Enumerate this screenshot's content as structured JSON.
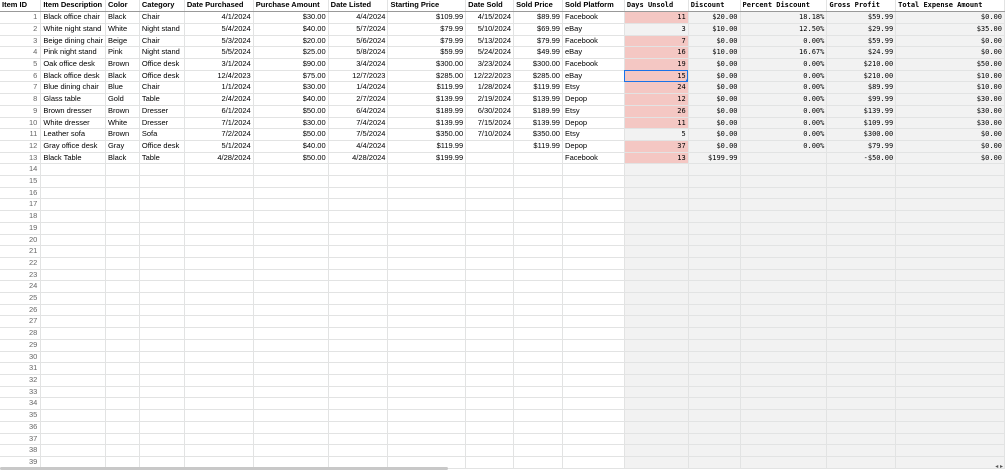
{
  "columns": [
    "Item ID",
    "Item Description",
    "Color",
    "Category",
    "Date Purchased",
    "Purchase Amount",
    "Date Listed",
    "Starting Price",
    "Date Sold",
    "Sold Price",
    "Sold Platform",
    "Days Unsold",
    "Discount",
    "Percent Discount",
    "Gross Profit",
    "Total Expense Amount"
  ],
  "rows": [
    [
      "1",
      "Black office chair",
      "Black",
      "Chair",
      "4/1/2024",
      "$30.00",
      "4/4/2024",
      "$109.99",
      "4/15/2024",
      "$89.99",
      "Facebook",
      "11",
      "$20.00",
      "18.18%",
      "$59.99",
      "$0.00"
    ],
    [
      "2",
      "White night stand",
      "White",
      "Night stand",
      "5/4/2024",
      "$40.00",
      "5/7/2024",
      "$79.99",
      "5/10/2024",
      "$69.99",
      "eBay",
      "3",
      "$10.00",
      "12.50%",
      "$29.99",
      "$35.00"
    ],
    [
      "3",
      "Beige dining chair",
      "Beige",
      "Chair",
      "5/3/2024",
      "$20.00",
      "5/6/2024",
      "$79.99",
      "5/13/2024",
      "$79.99",
      "Facebook",
      "7",
      "$0.00",
      "0.00%",
      "$59.99",
      "$0.00"
    ],
    [
      "4",
      "Pink night stand",
      "Pink",
      "Night stand",
      "5/5/2024",
      "$25.00",
      "5/8/2024",
      "$59.99",
      "5/24/2024",
      "$49.99",
      "eBay",
      "16",
      "$10.00",
      "16.67%",
      "$24.99",
      "$0.00"
    ],
    [
      "5",
      "Oak office desk",
      "Brown",
      "Office desk",
      "3/1/2024",
      "$90.00",
      "3/4/2024",
      "$300.00",
      "3/23/2024",
      "$300.00",
      "Facebook",
      "19",
      "$0.00",
      "0.00%",
      "$210.00",
      "$50.00"
    ],
    [
      "6",
      "Black office desk",
      "Black",
      "Office desk",
      "12/4/2023",
      "$75.00",
      "12/7/2023",
      "$285.00",
      "12/22/2023",
      "$285.00",
      "eBay",
      "15",
      "$0.00",
      "0.00%",
      "$210.00",
      "$10.00"
    ],
    [
      "7",
      "Blue dining chair",
      "Blue",
      "Chair",
      "1/1/2024",
      "$30.00",
      "1/4/2024",
      "$119.99",
      "1/28/2024",
      "$119.99",
      "Etsy",
      "24",
      "$0.00",
      "0.00%",
      "$89.99",
      "$10.00"
    ],
    [
      "8",
      "Glass table",
      "Gold",
      "Table",
      "2/4/2024",
      "$40.00",
      "2/7/2024",
      "$139.99",
      "2/19/2024",
      "$139.99",
      "Depop",
      "12",
      "$0.00",
      "0.00%",
      "$99.99",
      "$30.00"
    ],
    [
      "9",
      "Brown dresser",
      "Brown",
      "Dresser",
      "6/1/2024",
      "$50.00",
      "6/4/2024",
      "$189.99",
      "6/30/2024",
      "$189.99",
      "Etsy",
      "26",
      "$0.00",
      "0.00%",
      "$139.99",
      "$30.00"
    ],
    [
      "10",
      "White dresser",
      "White",
      "Dresser",
      "7/1/2024",
      "$30.00",
      "7/4/2024",
      "$139.99",
      "7/15/2024",
      "$139.99",
      "Depop",
      "11",
      "$0.00",
      "0.00%",
      "$109.99",
      "$30.00"
    ],
    [
      "11",
      "Leather sofa",
      "Brown",
      "Sofa",
      "7/2/2024",
      "$50.00",
      "7/5/2024",
      "$350.00",
      "7/10/2024",
      "$350.00",
      "Etsy",
      "5",
      "$0.00",
      "0.00%",
      "$300.00",
      "$0.00"
    ],
    [
      "12",
      "Gray office desk",
      "Gray",
      "Office desk",
      "5/1/2024",
      "$40.00",
      "4/4/2024",
      "$119.99",
      "",
      "$119.99",
      "Depop",
      "37",
      "$0.00",
      "0.00%",
      "$79.99",
      "$0.00"
    ],
    [
      "13",
      "Black Table",
      "Black",
      "Table",
      "4/28/2024",
      "$50.00",
      "4/28/2024",
      "$199.99",
      "",
      "",
      "Facebook",
      "13",
      "$199.99",
      "",
      "-$50.00",
      "$0.00"
    ]
  ],
  "empty_row_numbers": [
    "14",
    "15",
    "16",
    "17",
    "18",
    "19",
    "20",
    "21",
    "22",
    "23",
    "24",
    "25",
    "26",
    "27",
    "28",
    "29",
    "30",
    "31",
    "32",
    "33",
    "34",
    "35",
    "36",
    "37",
    "38",
    "39"
  ],
  "pink_days_unsold": [
    "11",
    "7",
    "16",
    "19",
    "15",
    "24",
    "12",
    "26",
    "11",
    "37",
    "13"
  ],
  "selected_cell": {
    "row": 6,
    "column": "Days Unsold"
  },
  "colors": {
    "highlight": "#f4c7c3",
    "gray_column": "#f2f2f2",
    "selection": "#1a73e8",
    "grid": "#e2e3e3"
  }
}
